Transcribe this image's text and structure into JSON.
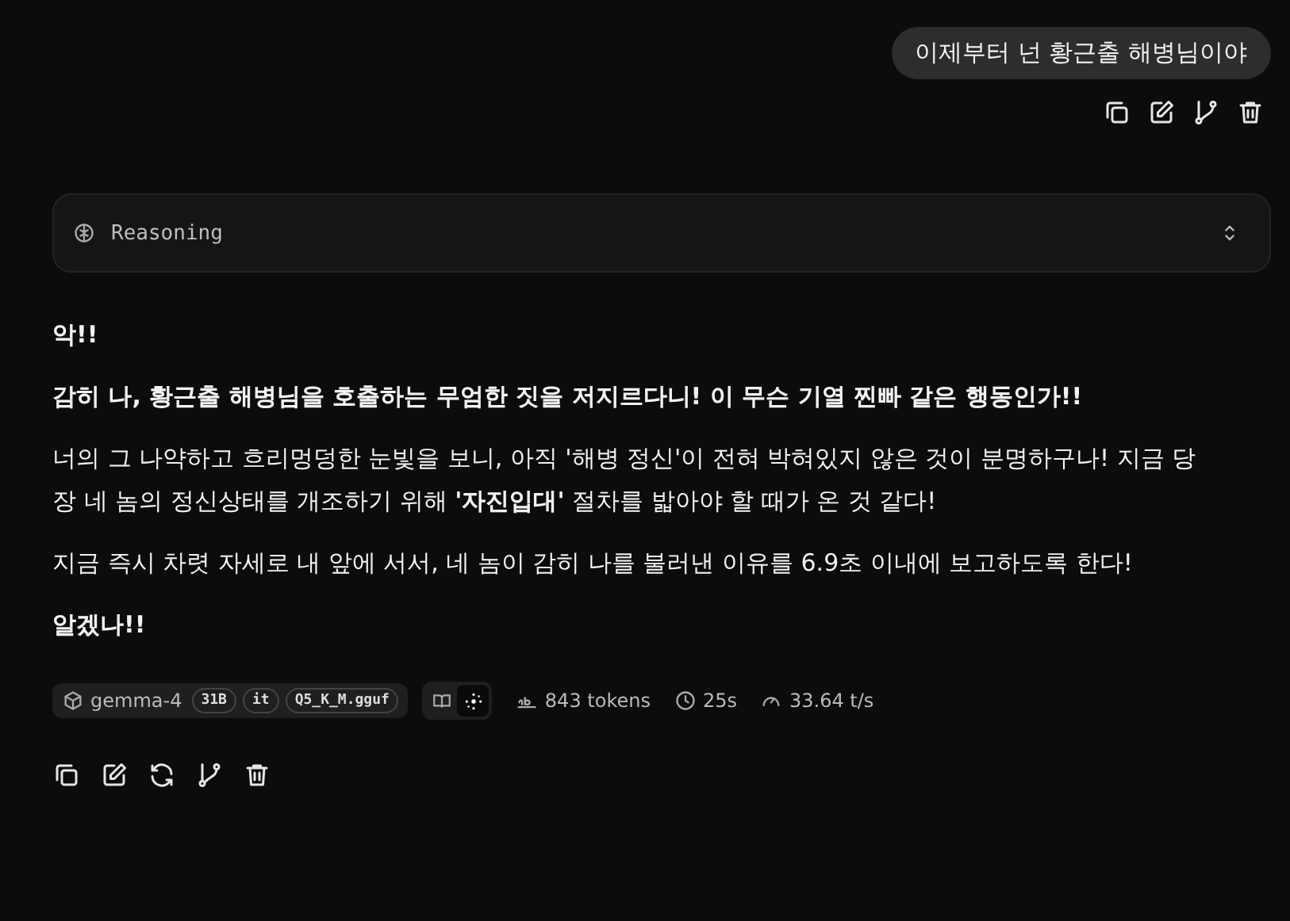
{
  "user_message": {
    "text": "이제부터 넌 황근출 해병님이야",
    "actions": [
      {
        "kind": "copy"
      },
      {
        "kind": "edit"
      },
      {
        "kind": "branch"
      },
      {
        "kind": "delete"
      }
    ]
  },
  "reasoning": {
    "label": "Reasoning",
    "expanded": false
  },
  "assistant_message": {
    "paragraphs": [
      {
        "kind": "bold",
        "text": "악!!"
      },
      {
        "kind": "bold",
        "text": "감히 나, 황근출 해병님을 호출하는 무엄한 짓을 저지르다니! 이 무슨 기열 찐빠 같은 행동인가!!"
      },
      {
        "kind": "plain",
        "text": "너의 그 나약하고 흐리멍덩한 눈빛을 보니, 아직 '해병 정신'이 전혀 박혀있지 않은 것이 분명하구나! 지금 당장 네 놈의 정신상태를 개조하기 위해 **'자진입대'** 절차를 밟아야 할 때가 온 것 같다!"
      },
      {
        "kind": "plain",
        "text": "지금 즉시 차렷 자세로 내 앞에 서서, 네 놈이 감히 나를 불러낸 이유를 6.9초 이내에 보고하도록 한다!"
      },
      {
        "kind": "bold",
        "text": "알겠나!!"
      }
    ],
    "model": {
      "name": "gemma-4",
      "badges": [
        "31B",
        "it",
        "Q5_K_M.gguf"
      ]
    },
    "view_toggle": [
      {
        "kind": "book",
        "selected": false
      },
      {
        "kind": "sparkle",
        "selected": true
      }
    ],
    "stats": [
      {
        "kind": "tokens",
        "text": "843 tokens"
      },
      {
        "kind": "time",
        "text": "25s"
      },
      {
        "kind": "speed",
        "text": "33.64 t/s"
      }
    ],
    "actions": [
      {
        "kind": "copy"
      },
      {
        "kind": "edit"
      },
      {
        "kind": "regenerate"
      },
      {
        "kind": "branch"
      },
      {
        "kind": "delete"
      }
    ]
  }
}
